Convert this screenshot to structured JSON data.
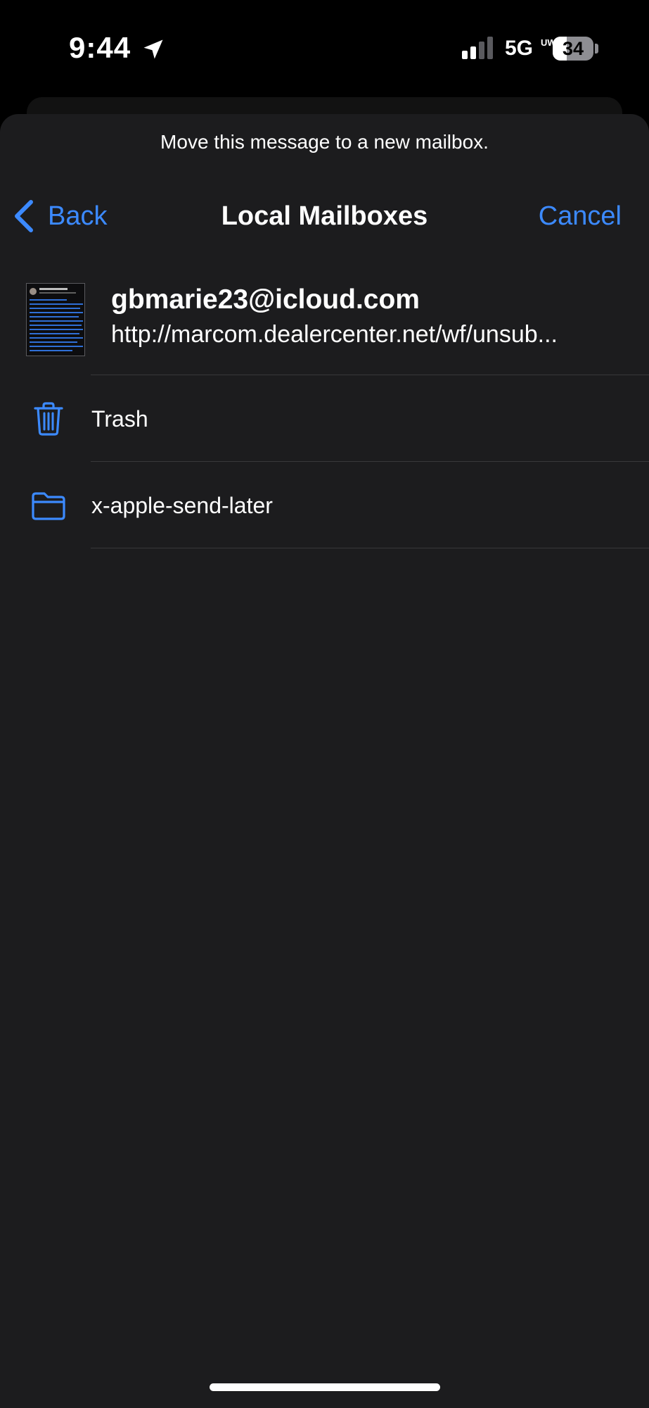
{
  "status_bar": {
    "time": "9:44",
    "network": "5G",
    "network_sub": "UW",
    "battery_level": "34",
    "battery_fraction": 0.34,
    "icons": [
      "location-arrow-icon",
      "cellular-signal-icon",
      "battery-icon"
    ]
  },
  "sheet": {
    "prompt": "Move this message to a new mailbox.",
    "nav": {
      "back_label": "Back",
      "title": "Local Mailboxes",
      "cancel_label": "Cancel"
    },
    "message": {
      "sender": "gbmarie23@icloud.com",
      "snippet": "http://marcom.dealercenter.net/wf/unsub..."
    },
    "mailboxes": [
      {
        "label": "Trash",
        "icon": "trash-icon"
      },
      {
        "label": "x-apple-send-later",
        "icon": "folder-icon"
      }
    ]
  },
  "colors": {
    "background": "#000000",
    "sheet": "#1c1c1e",
    "accent": "#3c8aff",
    "text": "#ffffff",
    "separator": "#38383a"
  }
}
